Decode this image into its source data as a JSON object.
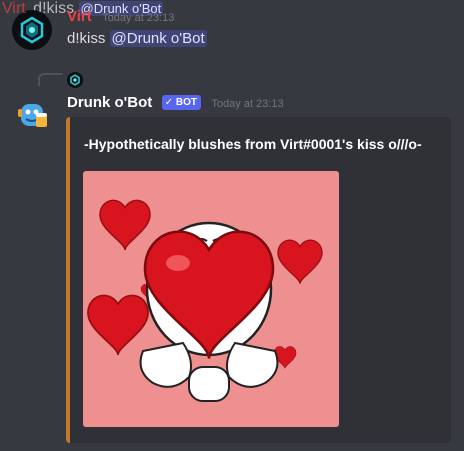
{
  "messages": [
    {
      "author": "Virt",
      "author_color": "#ed4245",
      "timestamp": "Today at 23:13",
      "text": "d!kiss",
      "mention": "@Drunk o'Bot"
    },
    {
      "reply": {
        "author": "Virt",
        "text": "d!kiss",
        "mention": "@Drunk o'Bot"
      },
      "author": "Drunk o'Bot",
      "author_color": "#ffffff",
      "bot_tag": "BOT",
      "bot_check": "✓",
      "timestamp": "Today at 23:13",
      "embed": {
        "title": "-Hypothetically blushes from Virt#0001's kiss o///o-",
        "border_color": "#c17a2b"
      }
    }
  ],
  "colors": {
    "background": "#36393f",
    "embed_background": "#2f3136",
    "mention_text": "#dee0fc",
    "bot_tag": "#5865f2",
    "image_background": "#ee9090"
  }
}
